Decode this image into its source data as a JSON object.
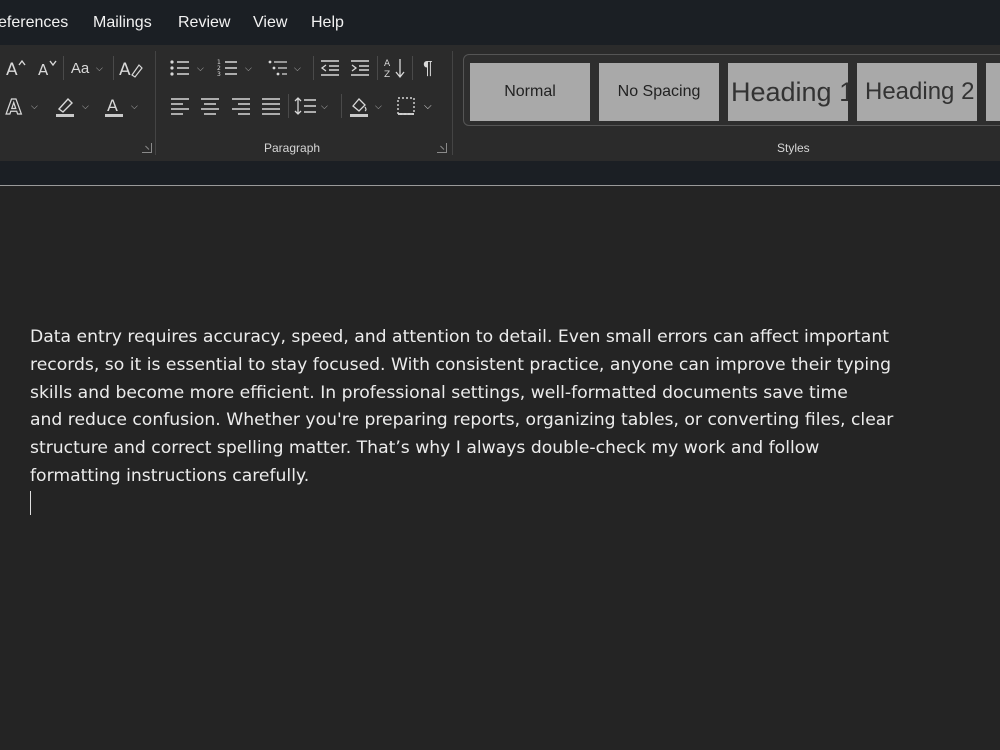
{
  "menu": {
    "items": [
      "eferences",
      "Mailings",
      "Review",
      "View",
      "Help"
    ]
  },
  "ribbon": {
    "font": {
      "change_case_label": "Aa"
    },
    "paragraph": {
      "label": "Paragraph"
    },
    "styles": {
      "label": "Styles",
      "items": [
        "Normal",
        "No Spacing",
        "Heading 1",
        "Heading 2"
      ]
    }
  },
  "document": {
    "lines": [
      "Data entry requires accuracy, speed, and attention to detail. Even small errors can affect important",
      "records, so it is essential to stay focused. With consistent practice, anyone can improve their typing",
      "skills and become more efficient. In professional settings, well-formatted documents save time",
      "and reduce confusion. Whether you're preparing reports, organizing tables, or converting files, clear",
      "structure and correct spelling matter. That’s why I always double-check my work and follow",
      "formatting instructions carefully."
    ]
  },
  "colors": {
    "menubar_bg": "#1b1f24",
    "ribbon_bg": "#2b2b2b",
    "document_bg": "#242424",
    "style_tile_bg": "#a9a9a9",
    "highlight_underline": "#c9c9c9",
    "text": "#ececec"
  }
}
